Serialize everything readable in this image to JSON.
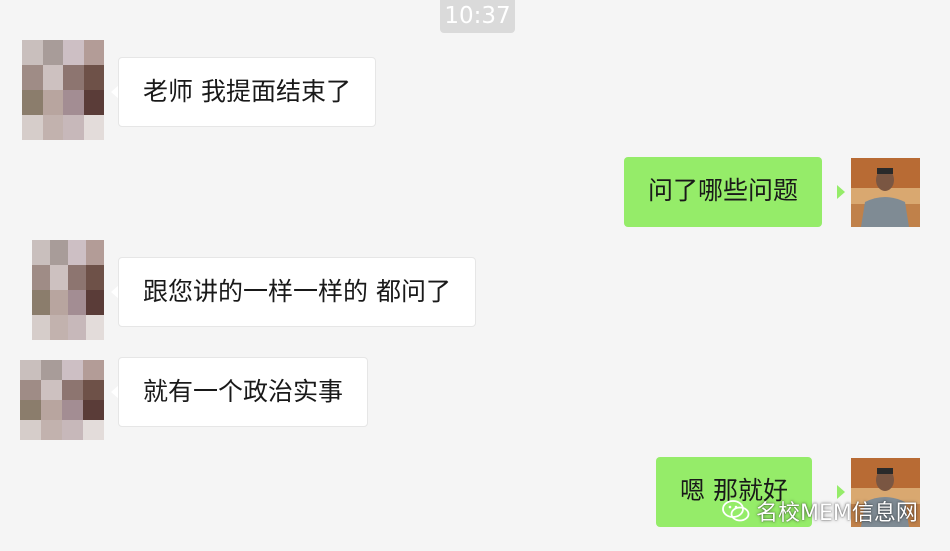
{
  "chat": {
    "timestamp": "10:37",
    "messages": [
      {
        "sender": "contact",
        "text": "老师 我提面结束了"
      },
      {
        "sender": "self",
        "text": "问了哪些问题"
      },
      {
        "sender": "contact",
        "text": "跟您讲的一样一样的 都问了"
      },
      {
        "sender": "contact",
        "text": "就有一个政治实事"
      },
      {
        "sender": "self",
        "text": "嗯  那就好"
      }
    ]
  },
  "watermark": {
    "text": "名校MEM信息网",
    "icon": "wechat-icon"
  },
  "colors": {
    "background": "#f5f5f5",
    "incoming_bubble": "#ffffff",
    "outgoing_bubble": "#95ec69",
    "timestamp_pill": "#dadada"
  }
}
